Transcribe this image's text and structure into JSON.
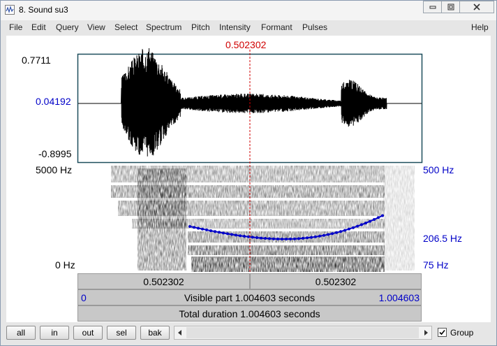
{
  "window": {
    "title": "8. Sound su3"
  },
  "menu": [
    "File",
    "Edit",
    "Query",
    "View",
    "Select",
    "Spectrum",
    "Pitch",
    "Intensity",
    "Formant",
    "Pulses",
    "Help"
  ],
  "cursor": {
    "time": "0.502302"
  },
  "waveform": {
    "y_max": "0.7711",
    "y_cursor": "0.04192",
    "y_min": "-0.8995"
  },
  "spectrogram": {
    "freq_max": "5000 Hz",
    "freq_min": "0 Hz"
  },
  "pitch": {
    "top": "500 Hz",
    "mid": "206.5 Hz",
    "bottom": "75 Hz"
  },
  "time_bar": {
    "left": "0.502302",
    "right": "0.502302"
  },
  "visible_bar": {
    "start": "0",
    "label": "Visible part 1.004603 seconds",
    "end": "1.004603"
  },
  "total_bar": {
    "label": "Total duration 1.004603 seconds"
  },
  "buttons": {
    "all": "all",
    "in": "in",
    "out": "out",
    "sel": "sel",
    "bak": "bak"
  },
  "group": {
    "label": "Group",
    "checked": true
  },
  "colors": {
    "cursor": "#d00000",
    "pitch": "#0000c8",
    "axis_blue": "#0000c8"
  }
}
